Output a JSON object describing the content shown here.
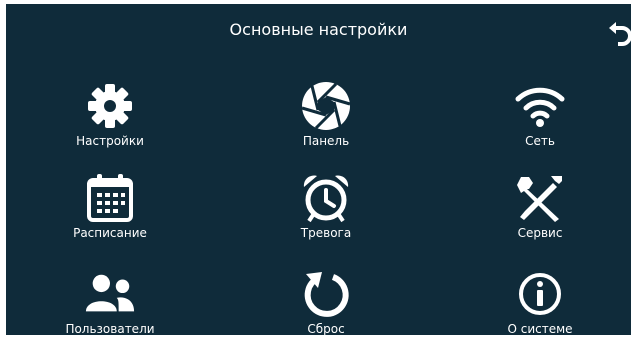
{
  "header": {
    "title": "Основные настройки",
    "back_icon": "back-arrow-icon"
  },
  "menu": [
    {
      "id": "settings",
      "label": "Настройки",
      "icon": "gear-icon"
    },
    {
      "id": "panel",
      "label": "Панель",
      "icon": "aperture-icon"
    },
    {
      "id": "network",
      "label": "Сеть",
      "icon": "wifi-icon"
    },
    {
      "id": "schedule",
      "label": "Расписание",
      "icon": "calendar-icon"
    },
    {
      "id": "alarm",
      "label": "Тревога",
      "icon": "alarm-clock-icon"
    },
    {
      "id": "service",
      "label": "Сервис",
      "icon": "tools-icon"
    },
    {
      "id": "users",
      "label": "Пользователи",
      "icon": "users-icon"
    },
    {
      "id": "reset",
      "label": "Сброс",
      "icon": "reset-icon"
    },
    {
      "id": "about",
      "label": "О системе",
      "icon": "info-icon"
    }
  ],
  "colors": {
    "background": "#0f2b3a",
    "foreground": "#ffffff"
  }
}
